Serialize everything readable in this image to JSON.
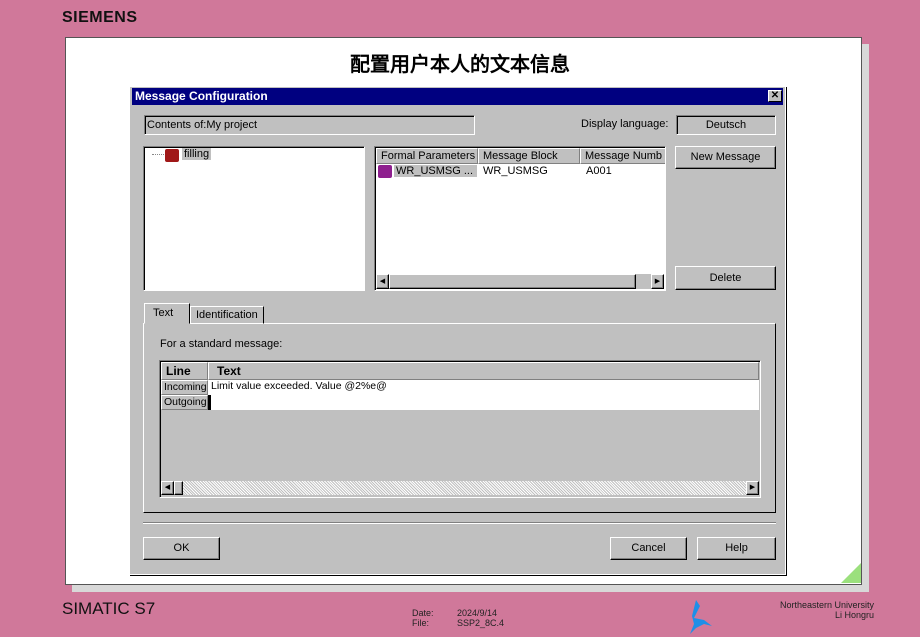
{
  "brand": "SIEMENS",
  "slide_title": "配置用户本人的文本信息",
  "dialog": {
    "title": "Message Configuration",
    "contents_of": "Contents of:My project",
    "display_language_label": "Display language:",
    "display_language": "Deutsch",
    "tree": [
      {
        "label": "filling",
        "icon": "station-icon"
      }
    ],
    "list": {
      "columns": [
        "Formal Parameters",
        "Message Block",
        "Message Numb"
      ],
      "rows": [
        [
          "WR_USMSG ...",
          "WR_USMSG",
          "A001"
        ]
      ]
    },
    "new_message": "New Message",
    "delete": "Delete",
    "tabs": [
      "Text",
      "Identification"
    ],
    "standard_label": "For a standard message:",
    "grid": {
      "columns": [
        "Line",
        "Text"
      ],
      "rows": [
        [
          "Incoming",
          "Limit value exceeded. Value @2%e@"
        ],
        [
          "Outgoing",
          ""
        ]
      ]
    },
    "ok": "OK",
    "cancel": "Cancel",
    "help": "Help"
  },
  "footer": {
    "product": "SIMATIC S7",
    "date_label": "Date:",
    "date": "2024/9/14",
    "file_label": "File:",
    "file": "SSP2_8C.4",
    "university": "Northeastern University",
    "author": "Li Hongru"
  }
}
